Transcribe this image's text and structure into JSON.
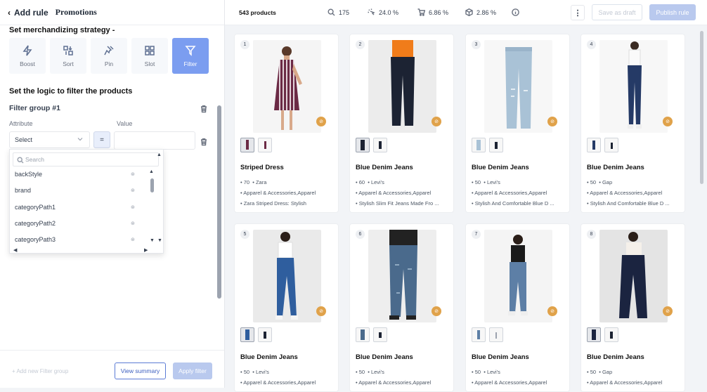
{
  "header": {
    "back_label": "Add rule",
    "page_title": "Promotions"
  },
  "strategy": {
    "title": "Set merchandizing strategy -",
    "items": [
      {
        "label": "Boost",
        "icon": "lightning-icon",
        "active": false
      },
      {
        "label": "Sort",
        "icon": "sort-icon",
        "active": false
      },
      {
        "label": "Pin",
        "icon": "pin-icon",
        "active": false
      },
      {
        "label": "Slot",
        "icon": "grid-icon",
        "active": false
      },
      {
        "label": "Filter",
        "icon": "filter-icon",
        "active": true
      }
    ]
  },
  "logic_title": "Set the logic to filter the products",
  "filter_group": {
    "title": "Filter group #1",
    "attribute_label": "Attribute",
    "value_label": "Value",
    "select_value": "Select",
    "operator": "=",
    "value": ""
  },
  "dropdown": {
    "search_placeholder": "Search",
    "options": [
      "backStyle",
      "brand",
      "categoryPath1",
      "categoryPath2",
      "categoryPath3"
    ]
  },
  "footer": {
    "add_group": "+ Add new Filter group",
    "view_summary": "View summary",
    "apply_filter": "Apply filter"
  },
  "toolbar": {
    "product_count": "543 products",
    "metrics": [
      {
        "icon": "search-icon",
        "value": "175"
      },
      {
        "icon": "click-icon",
        "value": "24.0 %"
      },
      {
        "icon": "cart-icon",
        "value": "6.86 %"
      },
      {
        "icon": "box-icon",
        "value": "2.86 %"
      }
    ],
    "save_draft": "Save as draft",
    "publish": "Publish rule"
  },
  "colors": {
    "accent": "#7b9df0",
    "badge": "#e0a24a"
  },
  "products": [
    {
      "num": "1",
      "title": "Striped Dress",
      "price": "70",
      "brand": "Zara",
      "category": "Apparel & Accessories,Apparel",
      "desc": "Zara Striped Dress: Stylish"
    },
    {
      "num": "2",
      "title": "Blue Denim Jeans",
      "price": "60",
      "brand": "Levi's",
      "category": "Apparel & Accessories,Apparel",
      "desc": "Stylish Slim Fit Jeans Made Fro ..."
    },
    {
      "num": "3",
      "title": "Blue Denim Jeans",
      "price": "50",
      "brand": "Levi's",
      "category": "Apparel & Accessories,Apparel",
      "desc": "Stylish And Comfortable Blue D ..."
    },
    {
      "num": "4",
      "title": "Blue Denim Jeans",
      "price": "50",
      "brand": "Gap",
      "category": "Apparel & Accessories,Apparel",
      "desc": "Stylish And Comfortable Blue D ..."
    },
    {
      "num": "5",
      "title": "Blue Denim Jeans",
      "price": "50",
      "brand": "Levi's",
      "category": "Apparel & Accessories,Apparel",
      "desc": ""
    },
    {
      "num": "6",
      "title": "Blue Denim Jeans",
      "price": "50",
      "brand": "Levi's",
      "category": "Apparel & Accessories,Apparel",
      "desc": ""
    },
    {
      "num": "7",
      "title": "Blue Denim Jeans",
      "price": "50",
      "brand": "Levi's",
      "category": "Apparel & Accessories,Apparel",
      "desc": ""
    },
    {
      "num": "8",
      "title": "Blue Denim Jeans",
      "price": "50",
      "brand": "Gap",
      "category": "Apparel & Accessories,Apparel",
      "desc": ""
    }
  ]
}
